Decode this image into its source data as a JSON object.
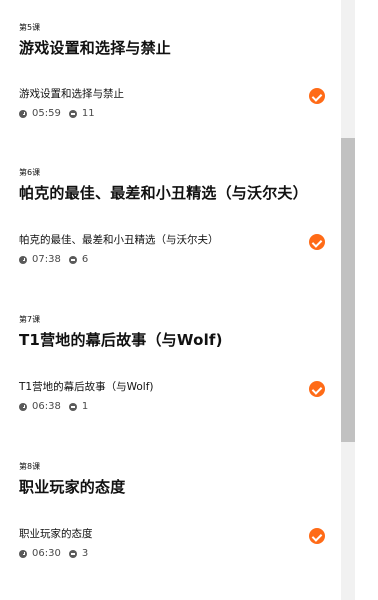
{
  "lessons": [
    {
      "number": "第5课",
      "title": "游戏设置和选择与禁止",
      "item": {
        "title": "游戏设置和选择与禁止",
        "duration": "05:59",
        "comments": "11",
        "completed": true
      }
    },
    {
      "number": "第6课",
      "title": "帕克的最佳、最差和小丑精选（与沃尔夫）",
      "item": {
        "title": "帕克的最佳、最差和小丑精选（与沃尔夫）",
        "duration": "07:38",
        "comments": "6",
        "completed": true
      }
    },
    {
      "number": "第7课",
      "title": "T1营地的幕后故事（与Wolf)",
      "item": {
        "title": "T1营地的幕后故事（与Wolf)",
        "duration": "06:38",
        "comments": "1",
        "completed": true
      }
    },
    {
      "number": "第8课",
      "title": "职业玩家的态度",
      "item": {
        "title": "职业玩家的态度",
        "duration": "06:30",
        "comments": "3",
        "completed": true
      }
    }
  ],
  "icons": {
    "duration": "clock-icon",
    "comments": "comment-icon",
    "completed": "check-circle-icon"
  },
  "colors": {
    "accent": "#ff6b17",
    "scroll_track": "#f1f1f1",
    "scroll_thumb": "#c1c1c1"
  }
}
